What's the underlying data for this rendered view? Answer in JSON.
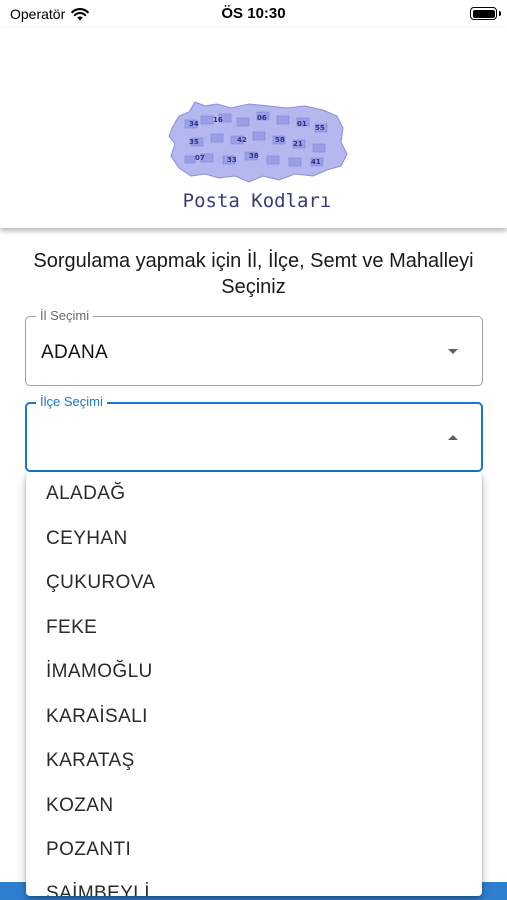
{
  "status_bar": {
    "carrier": "Operatör",
    "time": "ÖS 10:30"
  },
  "header": {
    "logo_title": "Posta Kodları",
    "map_numbers": [
      "34",
      "06",
      "35",
      "42",
      "16",
      "01",
      "58",
      "07",
      "33",
      "55",
      "21",
      "38",
      "41"
    ]
  },
  "prompt": "Sorgulama yapmak için İl, İlçe, Semt ve Mahalleyi Seçiniz",
  "il_select": {
    "label": "İl Seçimi",
    "value": "ADANA"
  },
  "ilce_select": {
    "label": "İlçe Seçimi",
    "value": "",
    "options": [
      "ALADAĞ",
      "CEYHAN",
      "ÇUKUROVA",
      "FEKE",
      "İMAMOĞLU",
      "KARAİSALI",
      "KARATAŞ",
      "KOZAN",
      "POZANTI",
      "SAİMBEYLİ"
    ]
  },
  "colors": {
    "accent": "#1976d2",
    "logo_text": "#3d3a78",
    "bottom_bar": "#2f7fcf"
  }
}
